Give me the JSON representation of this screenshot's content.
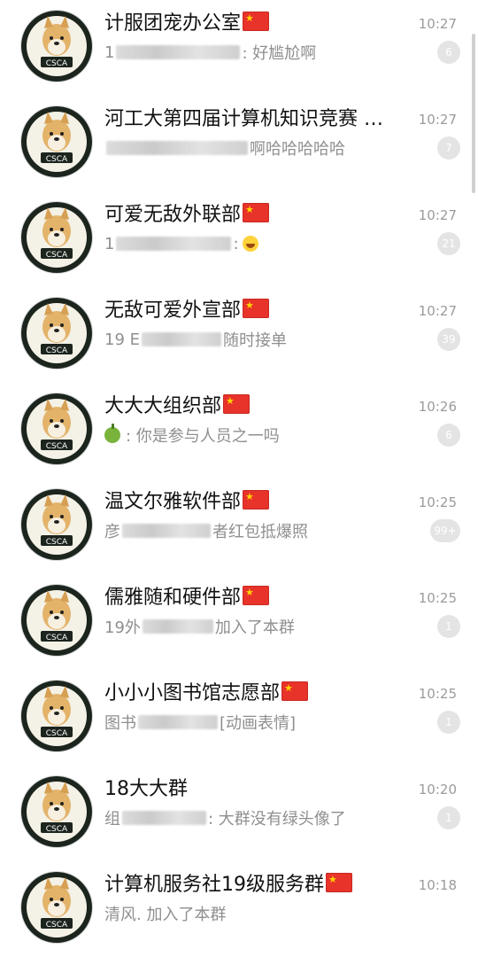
{
  "chats": [
    {
      "title": "计服团宠办公室",
      "flag": true,
      "time": "10:27",
      "preview_lead": "1",
      "preview_text": ": 好尴尬啊",
      "blur_width": 140,
      "badge": "6"
    },
    {
      "title": "河工大第四届计算机知识竞赛 …",
      "flag": false,
      "time": "10:27",
      "preview_lead": "",
      "preview_text": "啊哈哈哈哈哈",
      "blur_width": 160,
      "badge": "7"
    },
    {
      "title": "可爱无敌外联部",
      "flag": true,
      "time": "10:27",
      "preview_lead": "1",
      "preview_text": ":",
      "blur_width": 130,
      "badge": "21",
      "emoji": true
    },
    {
      "title": "无敌可爱外宣部",
      "flag": true,
      "time": "10:27",
      "preview_lead": "19 E",
      "preview_text": "随时接单",
      "blur_width": 90,
      "badge": "39"
    },
    {
      "title": "大大大组织部",
      "flag": true,
      "time": "10:26",
      "preview_lead": "",
      "preview_text": ": 你是参与人员之一吗",
      "blur_width": 0,
      "badge": "6",
      "apple": true
    },
    {
      "title": "温文尔雅软件部",
      "flag": true,
      "time": "10:25",
      "preview_lead": "彦",
      "preview_text": "者红包抵爆照",
      "blur_width": 100,
      "badge": "99+"
    },
    {
      "title": "儒雅随和硬件部",
      "flag": true,
      "time": "10:25",
      "preview_lead": "19外",
      "preview_text": "加入了本群",
      "blur_width": 80,
      "badge": "1"
    },
    {
      "title": "小小小图书馆志愿部",
      "flag": true,
      "time": "10:25",
      "preview_lead": "图书",
      "preview_text": "[动画表情]",
      "blur_width": 90,
      "badge": "1"
    },
    {
      "title": "18大大群",
      "flag": false,
      "time": "10:20",
      "preview_lead": "组",
      "preview_text": ": 大群没有绿头像了",
      "blur_width": 95,
      "badge": "1"
    },
    {
      "title": "计算机服务社19级服务群",
      "flag": true,
      "time": "10:18",
      "preview_lead": "",
      "preview_text": "清风. 加入了本群",
      "blur_width": 0,
      "badge": ""
    }
  ],
  "avatar_text": "CSCA"
}
